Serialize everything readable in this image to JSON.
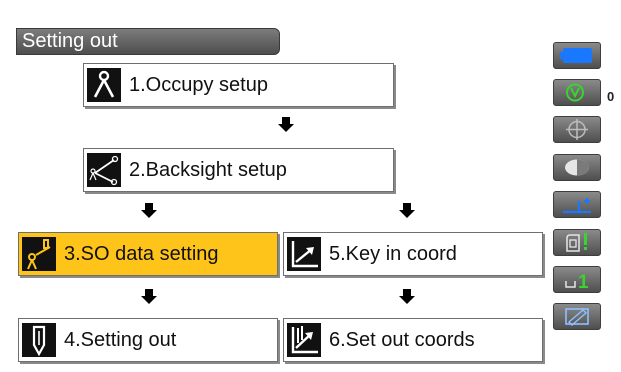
{
  "title": "Setting out",
  "menu": {
    "occupy": "1.Occupy setup",
    "backsight": "2.Backsight setup",
    "so_data": "3.SO data setting",
    "setting_out": "4.Setting out",
    "key_in": "5.Key in coord",
    "set_out_coords": "6.Set out coords",
    "selected": "3.SO data setting"
  },
  "status_bar": {
    "battery_icon": "battery-icon",
    "prism_icon": "prism-target-icon",
    "prism_constant": "0",
    "tilt_icon": "tilt-crosshair-icon",
    "laser_icon": "laser-pointer-icon",
    "tilt_correction_icon": "tilt-correction-icon",
    "input_mode_icon": "input-mode-icon",
    "input_mode_value": "1",
    "pen_icon": "pen-icon"
  },
  "colors": {
    "highlight": "#ffc41a",
    "battery": "#1a78ff",
    "accent_green": "#39d42f",
    "accent_blue": "#1a78ff"
  }
}
